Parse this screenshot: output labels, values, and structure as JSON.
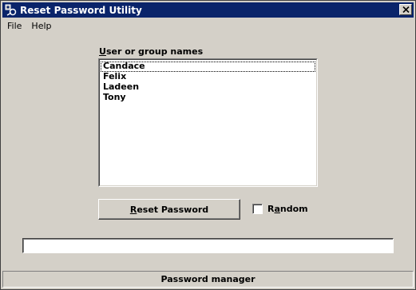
{
  "window": {
    "title": "Reset Password Utility",
    "app_icon": "key-icon",
    "close_icon": "close-icon"
  },
  "menu": {
    "items": [
      {
        "label": "File"
      },
      {
        "label": "Help"
      }
    ]
  },
  "users": {
    "label_first": "U",
    "label_rest": "ser or group names",
    "items": [
      {
        "name": "Candace",
        "focused": true
      },
      {
        "name": "Felix"
      },
      {
        "name": "Ladeen"
      },
      {
        "name": "Tony"
      }
    ]
  },
  "actions": {
    "reset_first": "R",
    "reset_rest": "eset Password",
    "random_before": "R",
    "random_accel": "a",
    "random_after": "ndom",
    "random_checked": false
  },
  "progress": {
    "value": 0
  },
  "status": {
    "text": "Password manager"
  },
  "colors": {
    "face": "#d4d0c8",
    "titlebar": "#0a246a"
  }
}
